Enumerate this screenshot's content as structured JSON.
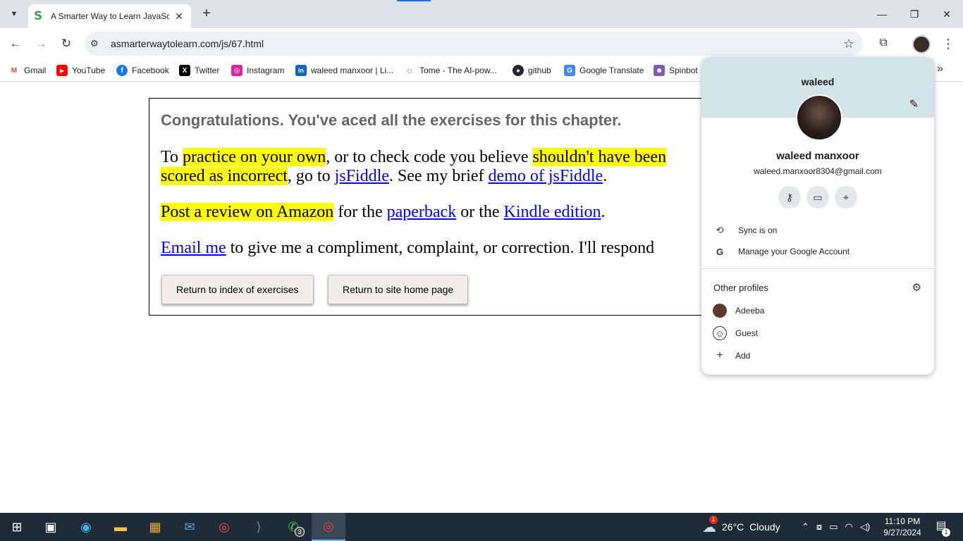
{
  "browser": {
    "tab": {
      "title": "A Smarter Way to Learn JavaScript",
      "favicon": "S"
    },
    "url": "asmarterwaytolearn.com/js/67.html",
    "bookmarks": [
      {
        "label": "Gmail",
        "icon": "M",
        "color": "#ea4335"
      },
      {
        "label": "YouTube",
        "icon": "▶",
        "color": "#ff0000"
      },
      {
        "label": "Facebook",
        "icon": "f",
        "color": "#1877f2"
      },
      {
        "label": "Twitter",
        "icon": "X",
        "color": "#000000"
      },
      {
        "label": "Instagram",
        "icon": "◎",
        "color": "#d6249f"
      },
      {
        "label": "waleed manxoor | Li...",
        "icon": "in",
        "color": "#0a66c2"
      },
      {
        "label": "Tome - The AI-pow...",
        "icon": "○",
        "color": "#e040fb"
      },
      {
        "label": "github",
        "icon": "●",
        "color": "#24292e"
      },
      {
        "label": "Google Translate",
        "icon": "G",
        "color": "#4285f4"
      },
      {
        "label": "Spinbot",
        "icon": "☻",
        "color": "#7b5ea7"
      }
    ]
  },
  "page": {
    "congrats": "Congratulations. You've aced all the exercises for this chapter.",
    "p1": {
      "t1": "To ",
      "hl1": "practice on your own",
      "t2": ", or to check code you believe ",
      "hl2": "shouldn't have been",
      "hl3": "scored as incorrect",
      "t3": ", go to ",
      "link1": "jsFiddle",
      "t4": ". See my brief ",
      "link2": "demo of jsFiddle",
      "t5": "."
    },
    "p2": {
      "hl": "Post a review on Amazon",
      "t1": " for the ",
      "link1": "paperback",
      "t2": " or the ",
      "link2": "Kindle edition",
      "t3": "."
    },
    "p3": {
      "link": "Email me",
      "t1": " to give me a compliment, complaint, or correction. I'll respond"
    },
    "buttons": {
      "index": "Return to index of exercises",
      "home": "Return to site home page"
    }
  },
  "profile_popup": {
    "name_top": "waleed",
    "full_name": "waleed manxoor",
    "email": "waleed.manxoor8304@gmail.com",
    "sync": "Sync is on",
    "manage": "Manage your Google Account",
    "other_profiles": "Other profiles",
    "profiles": [
      "Adeeba",
      "Guest"
    ],
    "add": "Add"
  },
  "taskbar": {
    "whatsapp_badge": "3",
    "weather_badge": "1",
    "temperature": "26°C",
    "weather": "Cloudy",
    "time": "11:10 PM",
    "date": "9/27/2024",
    "notif_count": "1"
  }
}
